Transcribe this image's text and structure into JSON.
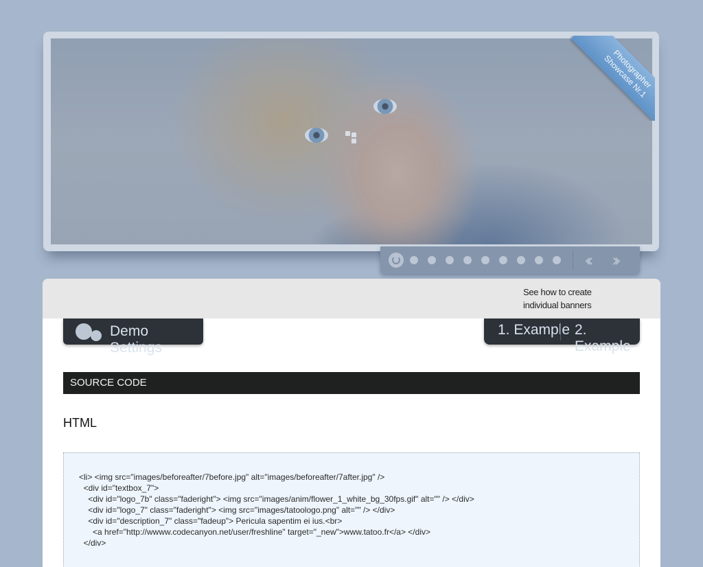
{
  "slider": {
    "ribbon_line1": "Photographer",
    "ribbon_line2": "Showcase Nr.1",
    "nav_dot_count": 9,
    "prev_icon": "double-chevron-left",
    "next_icon": "double-chevron-right"
  },
  "panel": {
    "individual_text": "See how to create individual banners",
    "demo_settings_label": "Demo Settings",
    "example1_label": "1. Example",
    "example2_label": "2. Example",
    "source_header": "SOURCE CODE",
    "html_heading": "HTML",
    "code_lines": [
      "<li> <img src=\"images/beforeafter/7before.jpg\" alt=\"images/beforeafter/7after.jpg\" />",
      "  <div id=\"textbox_7\">",
      "    <div id=\"logo_7b\" class=\"faderight\"> <img src=\"images/anim/flower_1_white_bg_30fps.gif\" alt=\"\" /> </div>",
      "    <div id=\"logo_7\" class=\"faderight\"> <img src=\"images/tatoologo.png\" alt=\"\" /> </div>",
      "    <div id=\"description_7\" class=\"fadeup\"> Pericula sapentim ei ius.<br>",
      "      <a href=\"http://wwww.codecanyon.net/user/freshline\" target=\"_new\">www.tatoo.fr</a> </div>",
      "  </div>"
    ]
  },
  "colors": {
    "page_bg": "#a6b6cc",
    "button_dark": "#2d3138",
    "ribbon_blue": "#6f9fd0"
  }
}
